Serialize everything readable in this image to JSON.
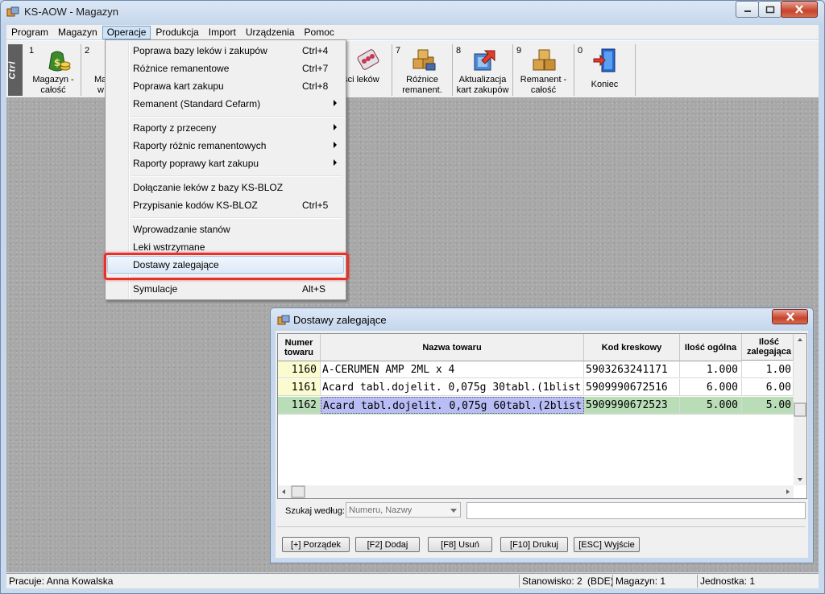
{
  "window": {
    "title": "KS-AOW - Magazyn"
  },
  "menubar": {
    "items": [
      "Program",
      "Magazyn",
      "Operacje",
      "Produkcja",
      "Import",
      "Urządzenia",
      "Pomoc"
    ],
    "active": "Operacje"
  },
  "toolbar": {
    "grip_label": "Ctrl",
    "buttons": [
      {
        "num": "1",
        "label1": "Magazyn -",
        "label2": "całość",
        "icon": "money-bag-icon"
      },
      {
        "num": "2",
        "label1": "Ma",
        "label2": "w",
        "icon": "warehouse-icon"
      },
      {
        "num": "",
        "label1": "ości leków",
        "label2": "",
        "icon": "pills-icon"
      },
      {
        "num": "7",
        "label1": "Różnice",
        "label2": "remanent.",
        "icon": "boxes-diff-icon"
      },
      {
        "num": "8",
        "label1": "Aktualizacja",
        "label2": "kart zakupów",
        "icon": "update-cards-icon"
      },
      {
        "num": "9",
        "label1": "Remanent -",
        "label2": "całość",
        "icon": "boxes-icon"
      },
      {
        "num": "0",
        "label1": "Koniec",
        "label2": "",
        "icon": "exit-door-icon"
      }
    ]
  },
  "operacje_menu": {
    "items": [
      {
        "label": "Poprawa bazy leków i zakupów",
        "shortcut": "Ctrl+4"
      },
      {
        "label": "Różnice remanentowe",
        "shortcut": "Ctrl+7"
      },
      {
        "label": "Poprawa kart zakupu",
        "shortcut": "Ctrl+8"
      },
      {
        "label": "Remanent (Standard Cefarm)",
        "shortcut": ""
      },
      {
        "label": "Raporty z przeceny",
        "shortcut": ""
      },
      {
        "label": "Raporty różnic remanentowych",
        "shortcut": ""
      },
      {
        "label": "Raporty poprawy kart zakupu",
        "shortcut": ""
      },
      {
        "label": "Dołączanie leków z bazy KS-BLOZ",
        "shortcut": ""
      },
      {
        "label": "Przypisanie kodów KS-BLOZ",
        "shortcut": "Ctrl+5"
      },
      {
        "label": "Wprowadzanie stanów",
        "shortcut": ""
      },
      {
        "label": "Leki wstrzymane",
        "shortcut": ""
      },
      {
        "label": "Dostawy zalegające",
        "shortcut": ""
      },
      {
        "label": "Symulacje",
        "shortcut": "Alt+S"
      }
    ]
  },
  "dialog": {
    "title": "Dostawy zalegające",
    "columns": [
      {
        "l1": "Numer",
        "l2": "towaru"
      },
      {
        "l1": "Nazwa towaru",
        "l2": ""
      },
      {
        "l1": "Kod kreskowy",
        "l2": ""
      },
      {
        "l1": "Ilość ogólna",
        "l2": ""
      },
      {
        "l1": "Ilość",
        "l2": "zalegająca"
      }
    ],
    "rows": [
      {
        "num": "1160",
        "name": "A-CERUMEN AMP 2ML x 4",
        "code": "5903263241171",
        "qty": "1.000",
        "late": "1.00"
      },
      {
        "num": "1161",
        "name": "Acard tabl.dojelit. 0,075g 30tabl.(1blist.",
        "code": "5909990672516",
        "qty": "6.000",
        "late": "6.00"
      },
      {
        "num": "1162",
        "name": "Acard tabl.dojelit. 0,075g 60tabl.(2blist.",
        "code": "5909990672523",
        "qty": "5.000",
        "late": "5.00"
      }
    ],
    "search_label": "Szukaj według:",
    "search_by": "Numeru, Nazwy",
    "search_value": "",
    "buttons": [
      "[+] Porządek",
      "[F2] Dodaj",
      "[F8] Usuń",
      "[F10] Drukuj",
      "[ESC] Wyjście"
    ]
  },
  "statusbar": {
    "user": "Pracuje: Anna Kowalska",
    "station": "Stanowisko: 2",
    "db": "(BDE)",
    "warehouse": "Magazyn: 1",
    "unit": "Jednostka: 1"
  },
  "colors": {
    "highlight_box": "#e8312b",
    "selected_row": "#b9ddb6",
    "selected_name_cell": "#b8bdf5",
    "number_cell": "#fbfbd0"
  }
}
